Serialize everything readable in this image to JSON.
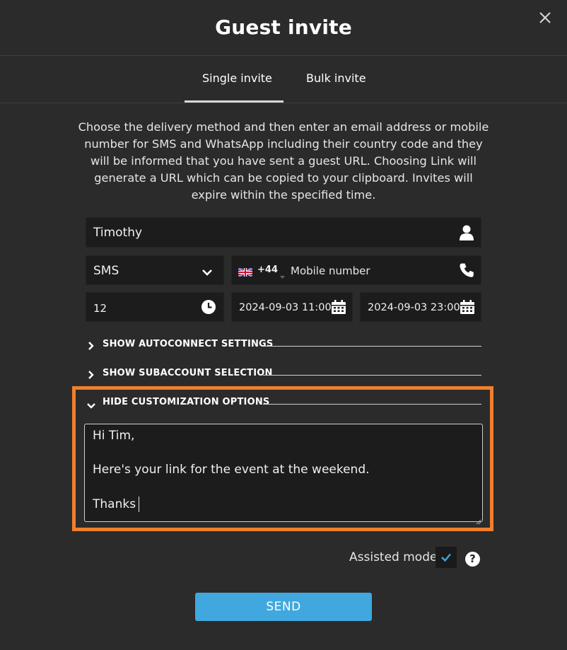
{
  "dialog": {
    "title": "Guest invite"
  },
  "tabs": [
    {
      "label": "Single invite",
      "active": true
    },
    {
      "label": "Bulk invite",
      "active": false
    }
  ],
  "description": "Choose the delivery method and then enter an email address or mobile number for SMS and WhatsApp including their country code and they will be informed that you have sent a guest URL. Choosing Link will generate a URL which can be copied to your clipboard. Invites will expire within the specified time.",
  "form": {
    "name_value": "Timothy",
    "delivery_method": "SMS",
    "country_code": "+44",
    "phone_placeholder": "Mobile number",
    "expiry_hours": "12",
    "start_datetime": "2024-09-03 11:00",
    "end_datetime": "2024-09-03 23:00"
  },
  "sections": {
    "autoconnect": "SHOW AUTOCONNECT SETTINGS",
    "subaccount": "SHOW SUBACCOUNT SELECTION",
    "customization": "HIDE CUSTOMIZATION OPTIONS"
  },
  "message": {
    "line1": "Hi Tim,",
    "line2": "Here's your link for the event at the weekend.",
    "line3": "Thanks"
  },
  "assisted_mode": {
    "label": "Assisted mode:",
    "checked": true
  },
  "help_label": "?",
  "send_label": "SEND",
  "colors": {
    "accent": "#40a8df",
    "highlight": "#f07f2e",
    "background": "#2b2b2b",
    "field": "#1c1c1c"
  },
  "icons": [
    "close-icon",
    "user-icon",
    "chevron-down-icon",
    "uk-flag-icon",
    "phone-icon",
    "clock-icon",
    "calendar-icon",
    "chevron-right-icon",
    "checkmark-icon",
    "help-icon"
  ]
}
